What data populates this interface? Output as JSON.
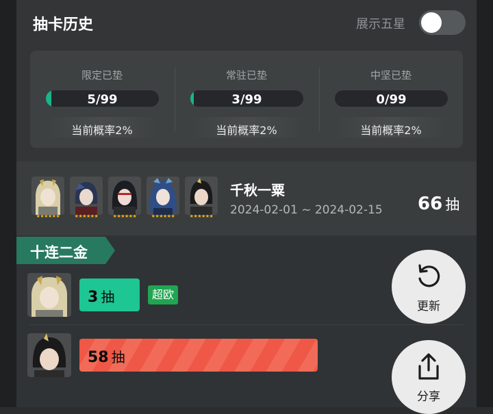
{
  "header": {
    "title": "抽卡历史",
    "toggle_label": "展示五星",
    "toggle_on": false
  },
  "stats": [
    {
      "title": "限定已垫",
      "count": "5/99",
      "progress": 0.05,
      "prob": "当前概率2%"
    },
    {
      "title": "常驻已垫",
      "count": "3/99",
      "progress": 0.03,
      "prob": "当前概率2%"
    },
    {
      "title": "中坚已垫",
      "count": "0/99",
      "progress": 0.0,
      "prob": "当前概率2%"
    }
  ],
  "banner": {
    "name": "千秋一粟",
    "date": "2024-02-01 ~ 2024-02-15",
    "pulls": "66",
    "pulls_unit": "抽",
    "stars": "★★★★★★",
    "operators": [
      "operator-avatar-1",
      "operator-avatar-2",
      "operator-avatar-3",
      "operator-avatar-4",
      "operator-avatar-5"
    ]
  },
  "group": {
    "label": "十连二金",
    "rows": [
      {
        "count": "3",
        "unit": "抽",
        "badge": "超欧",
        "color": "#1ec694"
      },
      {
        "count": "58",
        "unit": "抽",
        "color": "#ef5746"
      }
    ]
  },
  "actions": {
    "refresh_label": "更新",
    "share_label": "分享"
  },
  "colors": {
    "accent_green": "#19b58a",
    "tag_green": "#27795f",
    "badge_green": "#20a552",
    "star_gold": "#f2b41c",
    "bar_red": "#ef5746"
  }
}
